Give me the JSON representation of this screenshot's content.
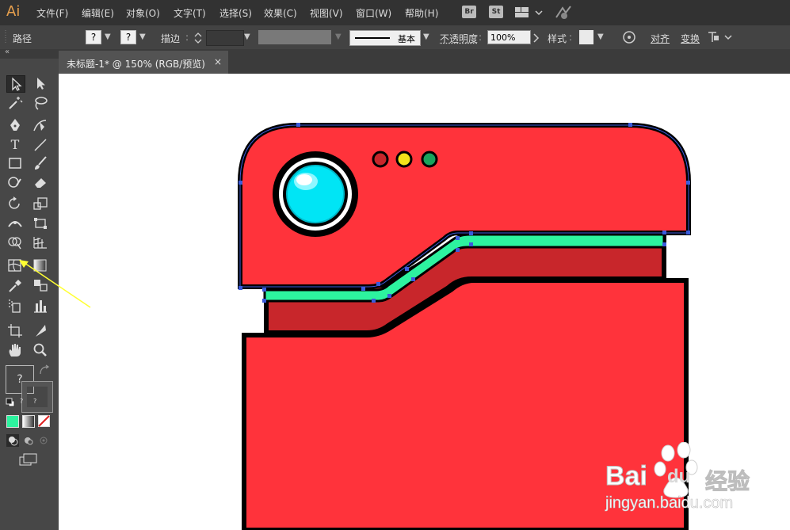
{
  "app": {
    "logo": "Ai"
  },
  "menu": {
    "items": [
      "文件(F)",
      "编辑(E)",
      "对象(O)",
      "文字(T)",
      "选择(S)",
      "效果(C)",
      "视图(V)",
      "窗口(W)",
      "帮助(H)"
    ],
    "bridge_label": "Br",
    "stock_label": "St"
  },
  "control": {
    "path_label": "路径",
    "fill_q": "?",
    "stroke_q": "?",
    "stroke_label": "描边",
    "stroke_style": "基本",
    "opacity_label": "不透明度",
    "opacity_value": "100%",
    "style_label": "样式",
    "align_label": "对齐",
    "transform_label": "变换"
  },
  "tab": {
    "title": "未标题-1* @ 150% (RGB/预览)",
    "close": "×"
  },
  "swatch": {
    "q": "?",
    "q_small1": "?",
    "q_small2": "?"
  },
  "watermark": {
    "brand": "Bai",
    "brand2": "du",
    "cn": "经验",
    "url": "jingyan.baidu.com"
  },
  "colors": {
    "body_red": "#ff333b",
    "dark_red": "#c8262b",
    "stripe_green": "#2df39f",
    "lens_cyan": "#00e5f5",
    "led_red": "#c8262b",
    "led_yellow": "#f5e21a",
    "led_green": "#1aa35c",
    "anchor_blue": "#3b5bdb",
    "arrow_yellow": "#ffff33"
  }
}
